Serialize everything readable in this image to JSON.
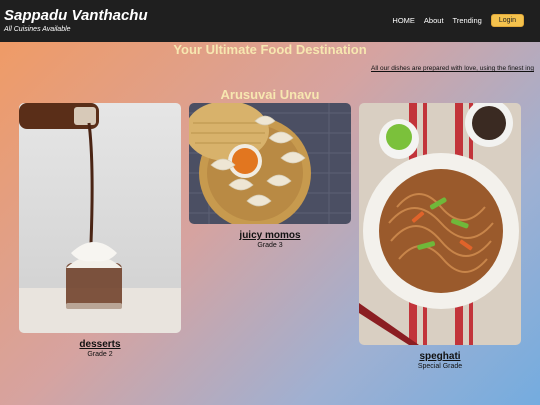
{
  "navbar": {
    "brand": "Sappadu Vanthachu",
    "tagline": "All Cuisines Available",
    "links": [
      "HOME",
      "About",
      "Trending"
    ],
    "login_label": "Login"
  },
  "hero": {
    "title": "Your Ultimate Food Destination",
    "marquee": "All our dishes are prepared with love, using the finest ing"
  },
  "section": {
    "title": "Arusuvai Unavu"
  },
  "cards": [
    {
      "name": "desserts",
      "grade": "Grade 2"
    },
    {
      "name": "juicy momos",
      "grade": "Grade 3"
    },
    {
      "name": "speghati",
      "grade": "Special Grade"
    }
  ],
  "colors": {
    "accent": "#f4c24d",
    "navbar": "#1f1f1f",
    "heading": "#f7e7b0"
  }
}
